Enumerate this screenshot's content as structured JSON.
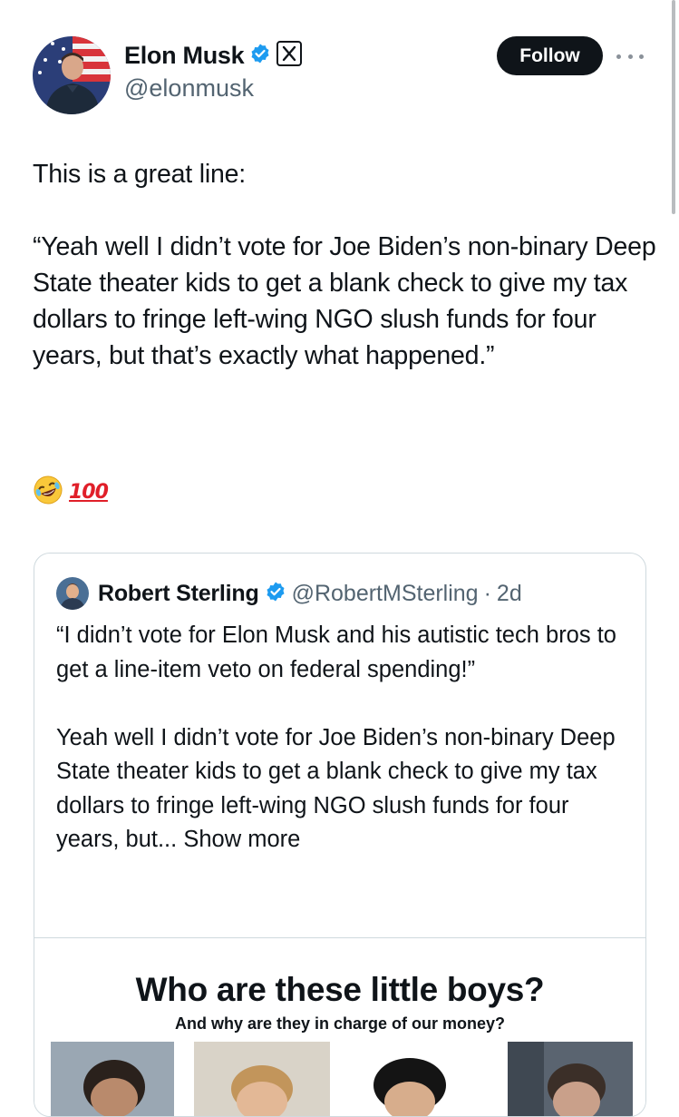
{
  "author": {
    "name": "Elon Musk",
    "handle": "@elonmusk",
    "verified_icon": "verified-badge-icon",
    "affiliate_icon": "x-logo-icon"
  },
  "actions": {
    "follow_label": "Follow",
    "more_icon": "ellipsis-icon"
  },
  "post": {
    "text": "This is a great line:\n\n“Yeah well I didn’t vote for Joe Biden’s non-binary Deep State theater kids to get a blank check to give my tax dollars to fringe left-wing NGO slush funds for four years, but that’s exactly what happened.”",
    "emoji_1": "🤣",
    "emoji_2": "100"
  },
  "quote": {
    "name": "Robert Sterling",
    "handle": "@RobertMSterling",
    "separator": "·",
    "time": "2d",
    "text": "“I didn’t vote for Elon Musk and his autistic tech bros to get a line-item veto on federal spending!”\n\nYeah well I didn’t vote for Joe Biden’s non-binary Deep State theater kids to get a blank check to give my tax dollars to fringe left-wing NGO slush funds for four years, but...",
    "show_more": "Show more",
    "image": {
      "title": "Who are these little boys?",
      "subtitle": "And why are they in charge of our money?"
    }
  },
  "colors": {
    "text": "#0f1419",
    "muted": "#536471",
    "verified": "#1d9bf0",
    "border": "#cfd9de",
    "button_bg": "#0f1419"
  }
}
